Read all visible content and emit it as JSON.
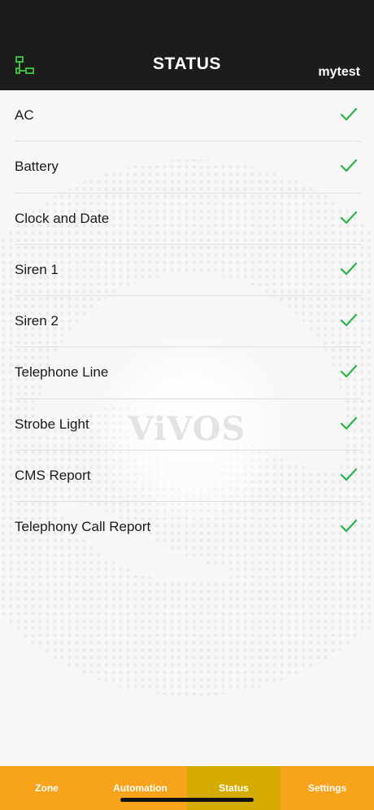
{
  "header": {
    "title": "STATUS",
    "user": "mytest",
    "left_icon": "network-icon",
    "icon_color": "#3dbb3d"
  },
  "watermark": {
    "brand": "ViVOS"
  },
  "status_items": [
    {
      "label": "AC",
      "status": "ok"
    },
    {
      "label": "Battery",
      "status": "ok"
    },
    {
      "label": "Clock and Date",
      "status": "ok"
    },
    {
      "label": "Siren 1",
      "status": "ok"
    },
    {
      "label": "Siren 2",
      "status": "ok"
    },
    {
      "label": "Telephone Line",
      "status": "ok"
    },
    {
      "label": "Strobe Light",
      "status": "ok"
    },
    {
      "label": "CMS Report",
      "status": "ok"
    },
    {
      "label": "Telephony Call Report",
      "status": "ok"
    }
  ],
  "status_icon": "checkmark-icon",
  "colors": {
    "header_bg": "#1c1c1c",
    "check": "#2bb24c",
    "tabbar": "#f8a31c",
    "tab_active": "#d6ab00"
  },
  "tabs": [
    {
      "label": "Zone",
      "active": false
    },
    {
      "label": "Automation",
      "active": false
    },
    {
      "label": "Status",
      "active": true
    },
    {
      "label": "Settings",
      "active": false
    }
  ]
}
